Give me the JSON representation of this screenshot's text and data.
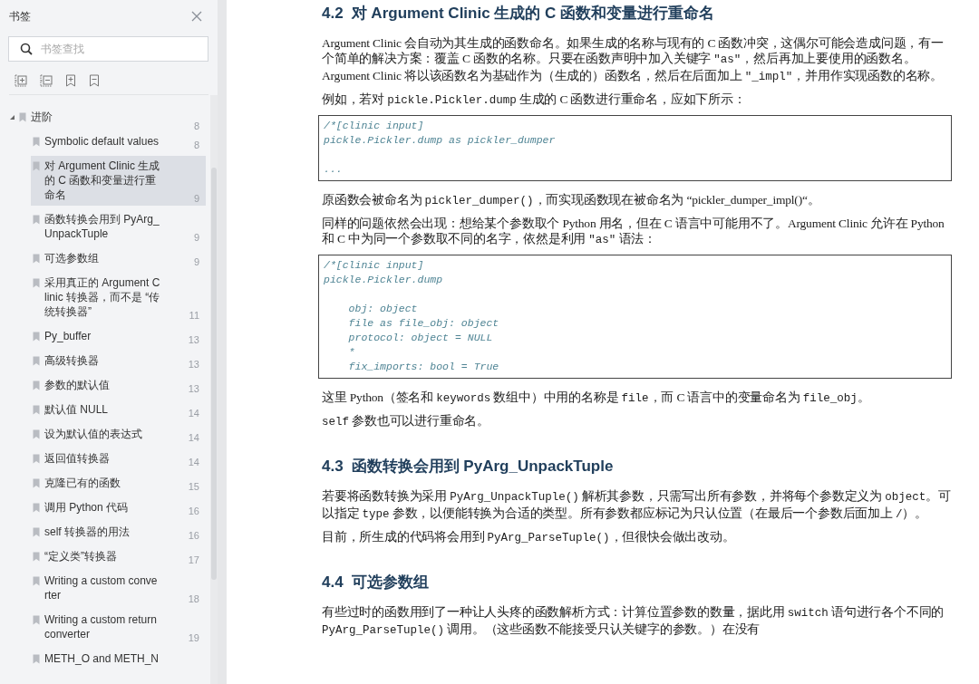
{
  "sidebar": {
    "title": "书签",
    "search": {
      "placeholder": "书签查找"
    },
    "tree": [
      {
        "label": "进阶",
        "page": "8",
        "expanded": true,
        "selected": false,
        "children": [
          {
            "label": "Symbolic default values",
            "page": "8",
            "selected": false
          },
          {
            "label": "对 Argument Clinic 生成的 C 函数和变量进行重命名",
            "page": "9",
            "selected": true
          },
          {
            "label": "函数转换会用到 PyArg_UnpackTuple",
            "page": "9",
            "selected": false
          },
          {
            "label": "可选参数组",
            "page": "9",
            "selected": false
          },
          {
            "label": "采用真正的 Argument Clinic 转换器，而不是 “传统转换器”",
            "page": "11",
            "selected": false
          },
          {
            "label": "Py_buffer",
            "page": "13",
            "selected": false
          },
          {
            "label": "高级转换器",
            "page": "13",
            "selected": false
          },
          {
            "label": "参数的默认值",
            "page": "13",
            "selected": false
          },
          {
            "label": "默认值 NULL",
            "page": "14",
            "selected": false
          },
          {
            "label": "设为默认值的表达式",
            "page": "14",
            "selected": false
          },
          {
            "label": "返回值转换器",
            "page": "14",
            "selected": false
          },
          {
            "label": "克隆已有的函数",
            "page": "15",
            "selected": false
          },
          {
            "label": "调用 Python 代码",
            "page": "16",
            "selected": false
          },
          {
            "label": "self 转换器的用法",
            "page": "16",
            "selected": false
          },
          {
            "label": "“定义类”转换器",
            "page": "17",
            "selected": false
          },
          {
            "label": "Writing a custom converter",
            "page": "18",
            "selected": false
          },
          {
            "label": "Writing a custom return converter",
            "page": "19",
            "selected": false
          },
          {
            "label": "METH_O and METH_N",
            "selected": false
          }
        ]
      }
    ]
  },
  "document": [
    {
      "kind": "heading",
      "number": "4.2",
      "text": "对 Argument Clinic 生成的 C 函数和变量进行重命名"
    },
    {
      "kind": "paragraph",
      "runs": [
        {
          "kind": "text",
          "text": "Argument Clinic 会自动为其生成的函数命名。如果生成的名称与现有的 C 函数冲突，这偶尔可能会造成问题，有一个简单的解决方案：覆盖 C 函数的名称。只要在函数声明中加入关键字 "
        },
        {
          "kind": "code",
          "text": "\"as\""
        },
        {
          "kind": "text",
          "text": "，然后再加上要使用的函数名。Argument Clinic 将以该函数名为基础作为（生成的）函数名，然后在后面加上 "
        },
        {
          "kind": "code",
          "text": "\"_impl\""
        },
        {
          "kind": "text",
          "text": "，并用作实现函数的名称。"
        }
      ]
    },
    {
      "kind": "paragraph",
      "runs": [
        {
          "kind": "text",
          "text": "例如，若对 "
        },
        {
          "kind": "code",
          "text": "pickle.Pickler.dump"
        },
        {
          "kind": "text",
          "text": " 生成的 C 函数进行重命名，应如下所示："
        }
      ]
    },
    {
      "kind": "code",
      "groups": [
        [
          "/*[clinic input]",
          "pickle.Pickler.dump as pickler_dumper"
        ],
        [
          "..."
        ]
      ]
    },
    {
      "kind": "paragraph",
      "runs": [
        {
          "kind": "text",
          "text": "原函数会被命名为 "
        },
        {
          "kind": "code",
          "text": "pickler_dumper()"
        },
        {
          "kind": "text",
          "text": "，而实现函数现在被命名为 “pickler_dumper_impl()“。"
        }
      ]
    },
    {
      "kind": "paragraph",
      "runs": [
        {
          "kind": "text",
          "text": "同样的问题依然会出现：想给某个参数取个 Python 用名，但在 C 语言中可能用不了。Argument Clinic 允许在 Python 和 C 中为同一个参数取不同的名字，依然是利用 "
        },
        {
          "kind": "code",
          "text": "\"as\""
        },
        {
          "kind": "text",
          "text": " 语法："
        }
      ]
    },
    {
      "kind": "code",
      "groups": [
        [
          "/*[clinic input]",
          "pickle.Pickler.dump"
        ],
        [
          "    obj: object",
          "    file as file_obj: object",
          "    protocol: object = NULL",
          "    *",
          "    fix_imports: bool = True"
        ]
      ]
    },
    {
      "kind": "paragraph",
      "runs": [
        {
          "kind": "text",
          "text": "这里 Python（签名和 "
        },
        {
          "kind": "code",
          "text": "keywords"
        },
        {
          "kind": "text",
          "text": " 数组中）中用的名称是 "
        },
        {
          "kind": "code",
          "text": "file"
        },
        {
          "kind": "text",
          "text": "，而 C 语言中的变量命名为 "
        },
        {
          "kind": "code",
          "text": "file_obj"
        },
        {
          "kind": "text",
          "text": "。"
        }
      ]
    },
    {
      "kind": "paragraph",
      "runs": [
        {
          "kind": "code",
          "text": "self"
        },
        {
          "kind": "text",
          "text": " 参数也可以进行重命名。"
        }
      ]
    },
    {
      "kind": "heading",
      "number": "4.3",
      "text": "函数转换会用到 PyArg_UnpackTuple"
    },
    {
      "kind": "paragraph",
      "runs": [
        {
          "kind": "text",
          "text": "若要将函数转换为采用 "
        },
        {
          "kind": "code",
          "text": "PyArg_UnpackTuple()"
        },
        {
          "kind": "text",
          "text": " 解析其参数，只需写出所有参数，并将每个参数定义为 "
        },
        {
          "kind": "code",
          "text": "object"
        },
        {
          "kind": "text",
          "text": "。可以指定 "
        },
        {
          "kind": "code",
          "text": "type"
        },
        {
          "kind": "text",
          "text": " 参数，以便能转换为合适的类型。所有参数都应标记为只认位置（在最后一个参数后面加上 "
        },
        {
          "kind": "code",
          "text": "/"
        },
        {
          "kind": "text",
          "text": "）。"
        }
      ]
    },
    {
      "kind": "paragraph",
      "runs": [
        {
          "kind": "text",
          "text": "目前，所生成的代码将会用到 "
        },
        {
          "kind": "code",
          "text": "PyArg_ParseTuple()"
        },
        {
          "kind": "text",
          "text": "，但很快会做出改动。"
        }
      ]
    },
    {
      "kind": "heading",
      "number": "4.4",
      "text": "可选参数组"
    },
    {
      "kind": "paragraph",
      "runs": [
        {
          "kind": "text",
          "text": "有些过时的函数用到了一种让人头疼的函数解析方式：计算位置参数的数量，据此用 "
        },
        {
          "kind": "code",
          "text": "switch"
        },
        {
          "kind": "text",
          "text": " 语句进行各个不同的 "
        },
        {
          "kind": "code",
          "text": "PyArg_ParseTuple()"
        },
        {
          "kind": "text",
          "text": " 调用。（这些函数不能接受只认关键字的参数。）在没有"
        }
      ]
    }
  ]
}
